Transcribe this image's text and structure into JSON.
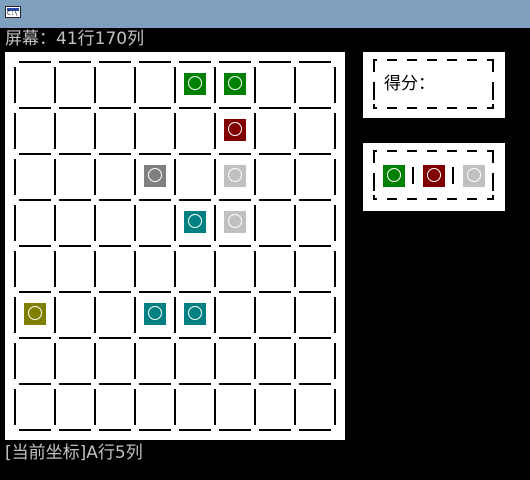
{
  "window": {
    "icon": "console-icon"
  },
  "screen_info": "屏幕：41行170列",
  "status": "[当前坐标]A行5列",
  "score": {
    "label": "得分："
  },
  "colors": {
    "green": "#008000",
    "red": "#800000",
    "gray": "#808080",
    "silver": "#c0c0c0",
    "teal": "#008080",
    "olive": "#808000"
  },
  "board": {
    "rows": 8,
    "cols": 8,
    "pieces": [
      {
        "row": 0,
        "col": 4,
        "color": "green"
      },
      {
        "row": 0,
        "col": 5,
        "color": "green"
      },
      {
        "row": 1,
        "col": 5,
        "color": "red"
      },
      {
        "row": 2,
        "col": 3,
        "color": "gray"
      },
      {
        "row": 2,
        "col": 5,
        "color": "silver"
      },
      {
        "row": 3,
        "col": 4,
        "color": "teal"
      },
      {
        "row": 3,
        "col": 5,
        "color": "silver"
      },
      {
        "row": 5,
        "col": 0,
        "color": "olive"
      },
      {
        "row": 5,
        "col": 3,
        "color": "teal"
      },
      {
        "row": 5,
        "col": 4,
        "color": "teal"
      }
    ]
  },
  "next_balls": [
    "green",
    "red",
    "silver"
  ]
}
